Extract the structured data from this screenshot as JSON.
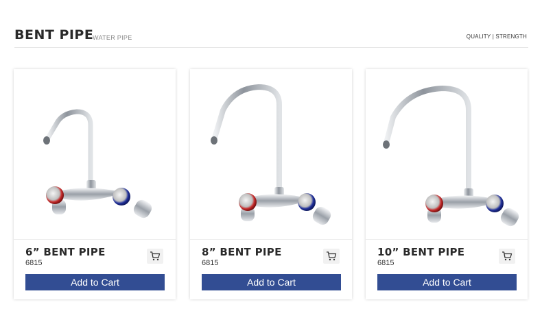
{
  "header": {
    "title": "BENT PIPE",
    "subtitle": "WATER PIPE",
    "tagline": "QUALITY | STRENGTH"
  },
  "products": [
    {
      "name": "6” BENT PIPE",
      "code": "6815",
      "add_label": "Add to Cart",
      "image_icon": "faucet-icon"
    },
    {
      "name": "8” BENT PIPE",
      "code": "6815",
      "add_label": "Add to Cart",
      "image_icon": "faucet-icon"
    },
    {
      "name": "10” BENT PIPE",
      "code": "6815",
      "add_label": "Add to Cart",
      "image_icon": "faucet-icon"
    }
  ],
  "icons": {
    "cart": "shopping-cart-icon"
  },
  "colors": {
    "button": "#324d93",
    "hot": "#c62a2a",
    "cold": "#1f2f9a",
    "chrome": "#b8bcc4"
  }
}
